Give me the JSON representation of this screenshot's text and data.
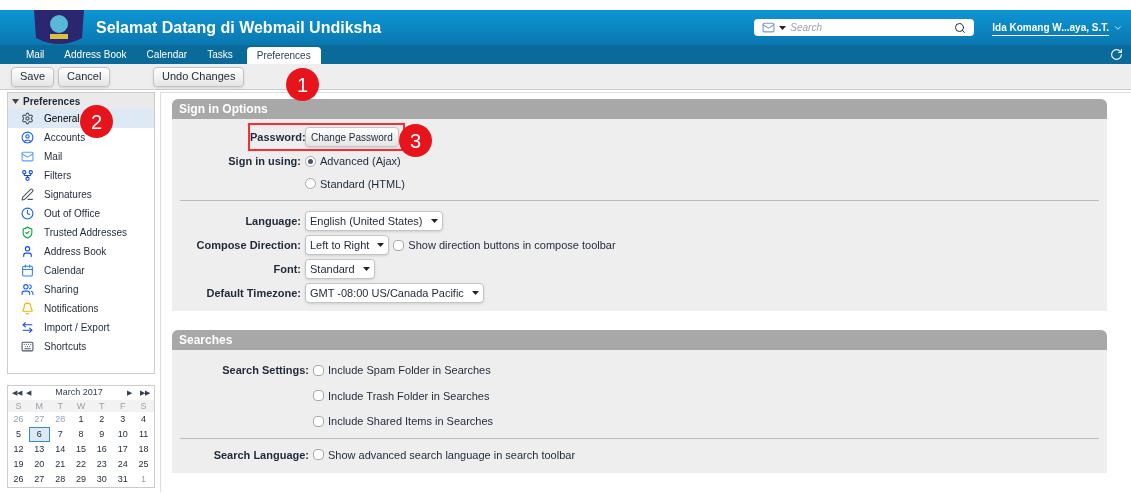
{
  "header": {
    "title": "Selamat Datang di Webmail Undiksha",
    "search": {
      "placeholder": "Search"
    },
    "user": "Ida Komang W...aya, S.T."
  },
  "tabs": [
    {
      "label": "Mail",
      "selected": false
    },
    {
      "label": "Address Book",
      "selected": false
    },
    {
      "label": "Calendar",
      "selected": false
    },
    {
      "label": "Tasks",
      "selected": false
    },
    {
      "label": "Preferences",
      "selected": true
    }
  ],
  "toolbar": {
    "left_buttons": [
      "Save",
      "Cancel"
    ],
    "main_buttons": [
      "Undo Changes"
    ]
  },
  "sidebar": {
    "title": "Preferences",
    "expanded": true,
    "items": [
      {
        "label": "General",
        "selected": true
      },
      {
        "label": "Accounts",
        "selected": false
      },
      {
        "label": "Mail",
        "selected": false
      },
      {
        "label": "Filters",
        "selected": false
      },
      {
        "label": "Signatures",
        "selected": false
      },
      {
        "label": "Out of Office",
        "selected": false
      },
      {
        "label": "Trusted Addresses",
        "selected": false
      },
      {
        "label": "Address Book",
        "selected": false
      },
      {
        "label": "Calendar",
        "selected": false
      },
      {
        "label": "Sharing",
        "selected": false
      },
      {
        "label": "Notifications",
        "selected": false
      },
      {
        "label": "Import / Export",
        "selected": false
      },
      {
        "label": "Shortcuts",
        "selected": false
      }
    ]
  },
  "mini_calendar": {
    "nav": [
      "◀◀",
      "◀",
      "▶",
      "▶▶"
    ],
    "month": "March 2017",
    "weekdays": [
      "S",
      "M",
      "T",
      "W",
      "T",
      "F",
      "S"
    ],
    "weeks": [
      [
        {
          "day": "26",
          "other_month": true,
          "selected": false
        },
        {
          "day": "27",
          "other_month": true,
          "selected": false
        },
        {
          "day": "28",
          "other_month": true,
          "selected": false
        },
        {
          "day": "1",
          "other_month": false,
          "selected": false
        },
        {
          "day": "2",
          "other_month": false,
          "selected": false
        },
        {
          "day": "3",
          "other_month": false,
          "selected": false
        },
        {
          "day": "4",
          "other_month": false,
          "selected": false
        }
      ],
      [
        {
          "day": "5",
          "other_month": false,
          "selected": false
        },
        {
          "day": "6",
          "other_month": false,
          "selected": true
        },
        {
          "day": "7",
          "other_month": false,
          "selected": false
        },
        {
          "day": "8",
          "other_month": false,
          "selected": false
        },
        {
          "day": "9",
          "other_month": false,
          "selected": false
        },
        {
          "day": "10",
          "other_month": false,
          "selected": false
        },
        {
          "day": "11",
          "other_month": false,
          "selected": false
        }
      ],
      [
        {
          "day": "12",
          "other_month": false,
          "selected": false
        },
        {
          "day": "13",
          "other_month": false,
          "selected": false
        },
        {
          "day": "14",
          "other_month": false,
          "selected": false
        },
        {
          "day": "15",
          "other_month": false,
          "selected": false
        },
        {
          "day": "16",
          "other_month": false,
          "selected": false
        },
        {
          "day": "17",
          "other_month": false,
          "selected": false
        },
        {
          "day": "18",
          "other_month": false,
          "selected": false
        }
      ],
      [
        {
          "day": "19",
          "other_month": false,
          "selected": false
        },
        {
          "day": "20",
          "other_month": false,
          "selected": false
        },
        {
          "day": "21",
          "other_month": false,
          "selected": false
        },
        {
          "day": "22",
          "other_month": false,
          "selected": false
        },
        {
          "day": "23",
          "other_month": false,
          "selected": false
        },
        {
          "day": "24",
          "other_month": false,
          "selected": false
        },
        {
          "day": "25",
          "other_month": false,
          "selected": false
        }
      ],
      [
        {
          "day": "26",
          "other_month": false,
          "selected": false
        },
        {
          "day": "27",
          "other_month": false,
          "selected": false
        },
        {
          "day": "28",
          "other_month": false,
          "selected": false
        },
        {
          "day": "29",
          "other_month": false,
          "selected": false
        },
        {
          "day": "30",
          "other_month": false,
          "selected": false
        },
        {
          "day": "31",
          "other_month": false,
          "selected": false
        },
        {
          "day": "1",
          "other_month": true,
          "selected": false
        }
      ]
    ]
  },
  "sections": [
    {
      "title": "Sign in Options",
      "rows": [
        {
          "kind": "button",
          "label": "Password:",
          "text": "Change Password",
          "highlighted": true
        },
        {
          "kind": "radios",
          "label": "Sign in using:",
          "options": [
            {
              "text": "Advanced (Ajax)",
              "selected": true
            },
            {
              "text": "Standard (HTML)",
              "selected": false
            }
          ]
        },
        {
          "kind": "divider"
        },
        {
          "kind": "select",
          "label": "Language:",
          "value": "English (United States)"
        },
        {
          "kind": "select",
          "label": "Compose Direction:",
          "value": "Left to Right",
          "checkbox": {
            "text": "Show direction buttons in compose toolbar",
            "checked": false
          }
        },
        {
          "kind": "select",
          "label": "Font:",
          "value": "Standard"
        },
        {
          "kind": "select",
          "label": "Default Timezone:",
          "value": "GMT -08:00 US/Canada Pacific"
        }
      ]
    },
    {
      "title": "Searches",
      "rows": [
        {
          "kind": "checks",
          "label": "Search Settings:",
          "options": [
            {
              "text": "Include Spam Folder in Searches",
              "checked": false
            },
            {
              "text": "Include Trash Folder in Searches",
              "checked": false
            },
            {
              "text": "Include Shared Items in Searches",
              "checked": false
            }
          ]
        },
        {
          "kind": "divider"
        },
        {
          "kind": "checks",
          "label": "Search Language:",
          "options": [
            {
              "text": "Show advanced search language in search toolbar",
              "checked": false
            }
          ]
        }
      ]
    }
  ],
  "callouts": [
    "1",
    "2",
    "3"
  ]
}
